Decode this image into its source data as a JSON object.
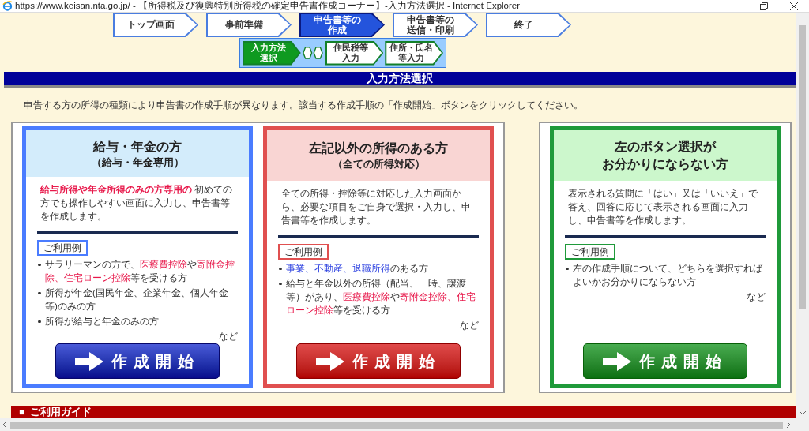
{
  "window": {
    "title": "https://www.keisan.nta.go.jp/ - 【所得税及び復興特別所得税の確定申告書作成コーナー】-入力方法選択 - Internet Explorer"
  },
  "steps": [
    {
      "lines": [
        "トップ画面"
      ],
      "selected": false
    },
    {
      "lines": [
        "事前準備"
      ],
      "selected": false
    },
    {
      "lines": [
        "申告書等の",
        "作成"
      ],
      "selected": true
    },
    {
      "lines": [
        "申告書等の",
        "送信・印刷"
      ],
      "selected": false
    },
    {
      "lines": [
        "終了"
      ],
      "selected": false
    }
  ],
  "substeps": [
    {
      "lines": [
        "入力方法",
        "選択"
      ],
      "selected": true
    },
    {
      "lines": [
        "住民税等",
        "入力"
      ],
      "selected": false
    },
    {
      "lines": [
        "住所・氏名",
        "等入力"
      ],
      "selected": false
    }
  ],
  "section_title": "入力方法選択",
  "instruction": "申告する方の所得の種類により申告書の作成手順が異なります。該当する作成手順の「作成開始」ボタンをクリックしてください。",
  "card_groups": [
    {
      "cards": [
        {
          "kind": "blue",
          "title_lines": [
            "給与・年金の方",
            "（給与・年金専用）"
          ],
          "description": [
            {
              "text": "給与所得や年金所得のみの方専用の",
              "kind": "strong"
            },
            {
              "text": " 初めての方でも操作しやすい画面に入力し、申告書等を作成します。",
              "kind": "plain"
            }
          ],
          "usage_label": "ご利用例",
          "examples": [
            [
              {
                "text": "サラリーマンの方で、",
                "kind": "plain"
              },
              {
                "text": "医療費控除",
                "kind": "red"
              },
              {
                "text": "や",
                "kind": "plain"
              },
              {
                "text": "寄附金控除、住宅ローン控除",
                "kind": "red"
              },
              {
                "text": "等を受ける方",
                "kind": "plain"
              }
            ],
            [
              {
                "text": "所得が年金(国民年金、企業年金、個人年金等)のみの方",
                "kind": "plain"
              }
            ],
            [
              {
                "text": "所得が給与と年金のみの方",
                "kind": "plain"
              }
            ]
          ],
          "etc": "など",
          "button": "作成開始"
        },
        {
          "kind": "red",
          "title_lines": [
            "左記以外の所得のある方",
            "（全ての所得対応）"
          ],
          "description": [
            {
              "text": "全ての所得・控除等に対応した入力画面から、必要な項目をご自身で選択・入力し、申告書等を作成します。",
              "kind": "plain"
            }
          ],
          "usage_label": "ご利用例",
          "examples": [
            [
              {
                "text": "事業、不動産、退職所得",
                "kind": "blue"
              },
              {
                "text": "のある方",
                "kind": "plain"
              }
            ],
            [
              {
                "text": "給与と年金以外の所得（配当、一時、譲渡等）があり、",
                "kind": "plain"
              },
              {
                "text": "医療費控除",
                "kind": "red"
              },
              {
                "text": "や",
                "kind": "plain"
              },
              {
                "text": "寄附金控除、住宅ローン控除",
                "kind": "red"
              },
              {
                "text": "等を受ける方",
                "kind": "plain"
              }
            ]
          ],
          "etc": "など",
          "button": "作成開始"
        }
      ]
    },
    {
      "cards": [
        {
          "kind": "green",
          "title_lines": [
            "左のボタン選択が",
            "お分かりにならない方"
          ],
          "description": [
            {
              "text": "表示される質問に「はい」又は「いいえ」で答え、回答に応じて表示される画面に入力し、申告書等を作成します。",
              "kind": "plain"
            }
          ],
          "usage_label": "ご利用例",
          "examples": [
            [
              {
                "text": "左の作成手順について、どちらを選択すればよいかお分かりにならない方",
                "kind": "plain"
              }
            ]
          ],
          "etc": "など",
          "button": "作成開始"
        }
      ]
    }
  ],
  "guide": {
    "bullet": "■",
    "title": "ご利用ガイド"
  }
}
